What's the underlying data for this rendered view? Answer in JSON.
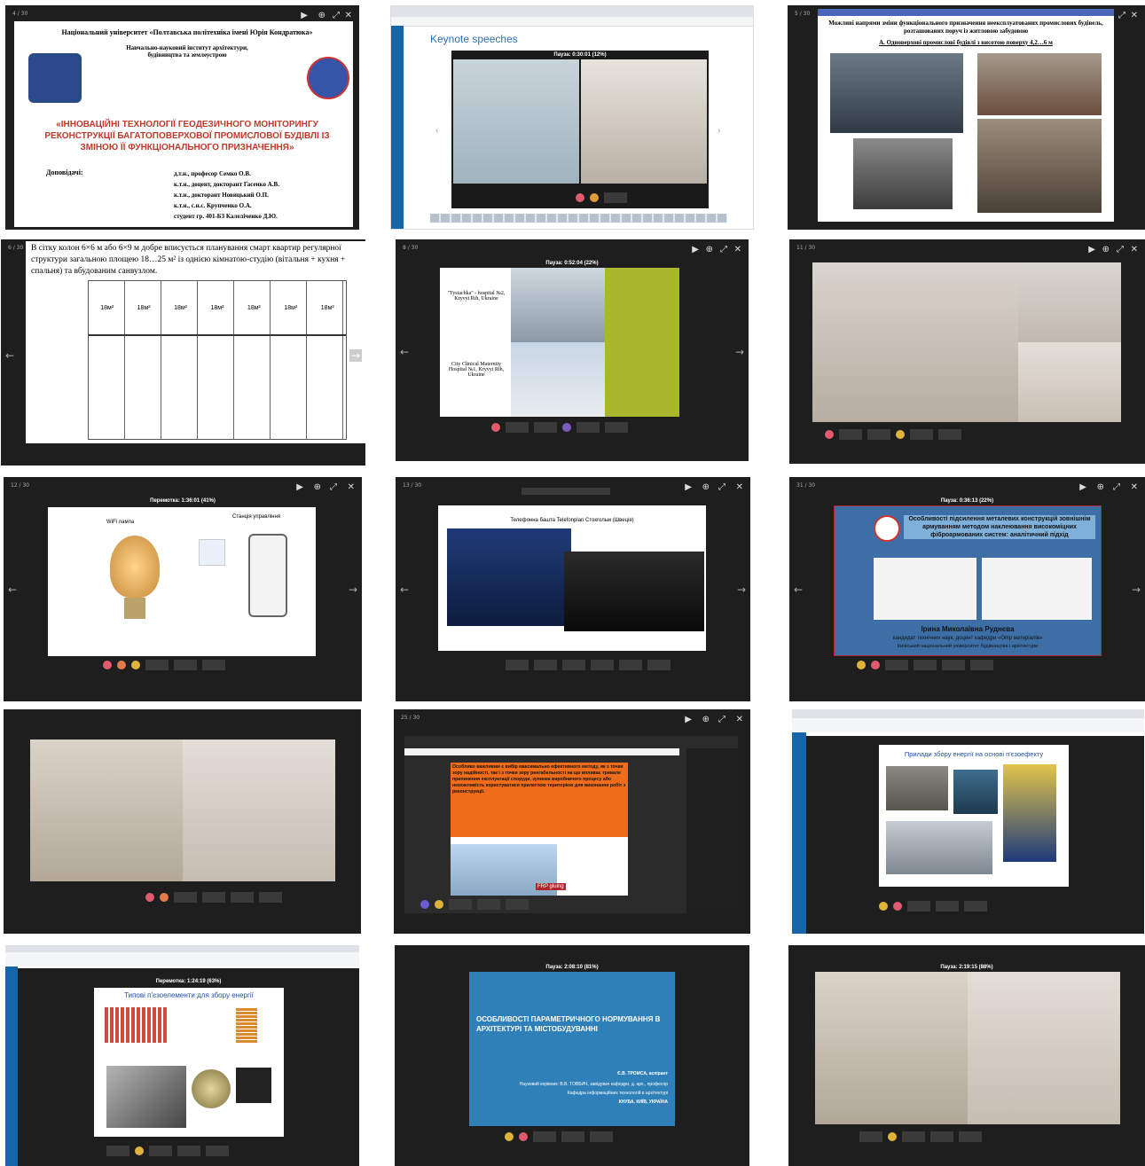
{
  "tiles": {
    "t1": {
      "counter": "4 / 30",
      "university": "Національний університет «Полтавська політехніка імені Юрія Кондратюка»",
      "institute": "Навчально-науковий інститут архітектури, будівництва та землеустрою",
      "title": "«ІННОВАЦІЙНІ ТЕХНОЛОГІЇ ГЕОДЕЗИЧНОГО МОНІТОРИНГУ РЕКОНСТРУКЦІЇ БАГАТОПОВЕРХОВОЇ ПРОМИСЛОВОЇ БУДІВЛІ ІЗ ЗМІНОЮ ЇЇ ФУНКЦІОНАЛЬНОГО ПРИЗНАЧЕННЯ»",
      "speakers_label": "Доповідачі:",
      "speakers": [
        "д.т.н., професор Семко О.В.",
        "к.т.н., доцент, докторант Гасенко А.В.",
        "к.т.н., докторант Новицький О.П.",
        "к.т.н., с.н.с. Крупченко О.А.",
        "студент гр. 401-БЗ Калеліченко Д.Ю."
      ]
    },
    "t2": {
      "heading": "Keynote speeches",
      "pause": "Пауза: 0:30:01 (12%)"
    },
    "t3": {
      "counter": "5 / 30",
      "title": "Можливі напрями зміни функціонального призначення неексплуатованих промислових будівель, розташованих поруч із житловою забудовою",
      "subtitle": "А. Одноверхові промислові будівлі з висотою поверху 4,2…6 м"
    },
    "t4": {
      "counter": "6 / 30",
      "text": "В сітку колон 6×6 м або 6×9 м добре вписується планування смарт квартир регулярної структури загальною площею 18…25 м² із однією кімнатою-студію (вітальня + кухня + спальня) та вбудованим санвузлом.",
      "room_labels": [
        "18м²",
        "18м²",
        "18м²",
        "18м²",
        "18м²",
        "18м²",
        "18м²"
      ]
    },
    "t5": {
      "counter": "8 / 30",
      "pause": "Пауза: 0:52:04 (22%)",
      "caption1": "\"Tysiachka\" - hospital №2, Kryvyi Rih, Ukraine",
      "caption2": "City Clinical Maternity Hospital №1, Kryvyi Rih, Ukraine"
    },
    "t6": {
      "counter": "11 / 30"
    },
    "t7": {
      "counter": "12 / 30",
      "pause": "Перемотка: 1:36:01 (41%)",
      "label_left": "WiFi лампа",
      "label_right": "Станція управління"
    },
    "t8": {
      "counter": "13 / 30",
      "title": "Телефонна башта Telefonplan Стокгольм (Швеція)"
    },
    "t9": {
      "counter": "31 / 30",
      "pause": "Пауза: 0:36:13 (22%)",
      "title": "Особливості підсилення металевих конструкцій зовнішнім армуванням методом наклеювання високоміцних фіброармованих систем: аналітичний підхід",
      "speaker": "Ірина Миколаївна Руднєва",
      "position": "кандидат технічних наук, доцент кафедри «Опір матеріалів»",
      "org": "Київський національний університет будівництва і архітектури"
    },
    "t10": {},
    "t11": {
      "counter": "25 / 30",
      "text": "Особливо важливим є вибір максимально ефективного методу, як з точки зору надійності, так і з точки зору ренгабельності на що впливає тривале припинення експлуатації споруди, зупинка виробничого процесу або неможливість користуватися прилеглою територією для виконання робіт з реконструкції.",
      "badge": "FRP gluing"
    },
    "t12": {
      "title": "Прилади збору енергії на основі п'єзоефекту"
    },
    "t13": {
      "pause": "Перемотка: 1:24:19 (63%)",
      "title": "Типові п'єзоелементи для збору енергії"
    },
    "t14": {
      "pause": "Пауза: 2:08:10 (81%)",
      "title": "ОСОБЛИВОСТІ ПАРАМЕТРИЧНОГО НОРМУВАННЯ В АРХІТЕКТУРІ ТА МІСТОБУДУВАННІ",
      "author": "Є.В. ТРОМСА, аспірант",
      "supervisor": "Науковий керівник: В.В. ТОВБИЧ, завідувач кафедри, д. арх., професор",
      "dept": "Кафедра інформаційних технологій в архітектурі",
      "city": "КНУБА, КИЇВ, УКРАЇНА"
    },
    "t15": {
      "pause": "Пауза: 2:19:15 (88%)"
    }
  },
  "colors": {
    "accent_red": "#c0392b",
    "olive": "#a8b82a",
    "slide_blue": "#2f7fb8"
  }
}
